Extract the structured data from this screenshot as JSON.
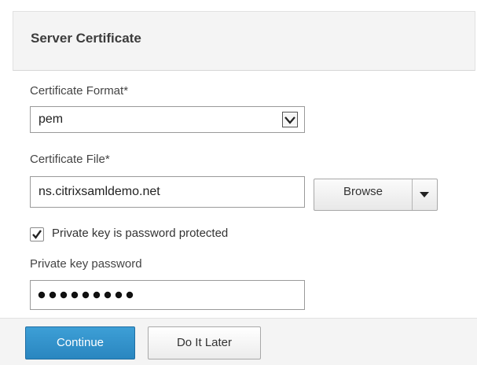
{
  "panel": {
    "title": "Server Certificate"
  },
  "certificate_format": {
    "label": "Certificate Format*",
    "selected": "pem"
  },
  "certificate_file": {
    "label": "Certificate File*",
    "value": "ns.citrixsamldemo.net",
    "browse_label": "Browse"
  },
  "private_key_protected": {
    "label": "Private key is password protected",
    "checked": true
  },
  "private_key_password": {
    "label": "Private key password",
    "masked_length": 9
  },
  "footer": {
    "continue_label": "Continue",
    "later_label": "Do It Later"
  },
  "colors": {
    "primary": "#2a86c0",
    "header_bg": "#f4f4f4"
  },
  "icons": {
    "select_arrow": "chevron-down-icon",
    "browse_caret": "caret-down-icon",
    "checkbox": "checkmark-icon"
  }
}
